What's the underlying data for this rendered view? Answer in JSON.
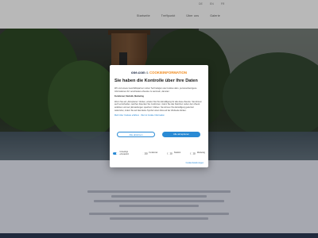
{
  "header": {
    "languages": [
      "DE",
      "EN",
      "FR"
    ],
    "nav": [
      "Startseite",
      "Treffpunkt",
      "Über uns",
      "Galerie"
    ]
  },
  "consent": {
    "brand_one": "one.com",
    "brand_amp": "&",
    "brand_partner": "COOKIEINFORMATION",
    "title": "Sie haben die Kontrolle über Ihre Daten",
    "paragraph1": "Wir und unsere Geschäftspartner nutzen Technologien wie Cookies dazu, personenbezogene Informationen für verschiedene Zwecke zu sammeln, darunter:",
    "purposes": "Funktional, Statistik, Marketing",
    "paragraph2": "Wenn Sie auf „Akzeptieren“ klicken, erteilen Sie Ihre Einwilligung für alle diese Zwecke. Sie können auch entscheiden, welchen Zwecken Sie zustimmen, indem Sie das Kästchen neben dem Zweck anklicken und auf „Einstellungen speichern“ klicken. Sie können Ihre Einwilligung jederzeit widerrufen, indem Sie auf das kleine Symbol unten links auf der Webseite klicken.",
    "links": "Mehr über Cookies erfahren · Wer ist Cookie Information",
    "reject_label": "Alle ablehnen",
    "accept_label": "Alle akzeptieren",
    "toggles": [
      {
        "label": "Unbedingt erforderlich",
        "on": true
      },
      {
        "label": "Funktional",
        "on": false
      },
      {
        "label": "Statistik",
        "on": false
      },
      {
        "label": "Marketing",
        "on": false
      }
    ],
    "details_label": "Cookie-Details zeigen"
  },
  "colors": {
    "accent": "#2a8ad4",
    "brand_orange": "#f08a1c",
    "footer": "#2d3b55"
  }
}
